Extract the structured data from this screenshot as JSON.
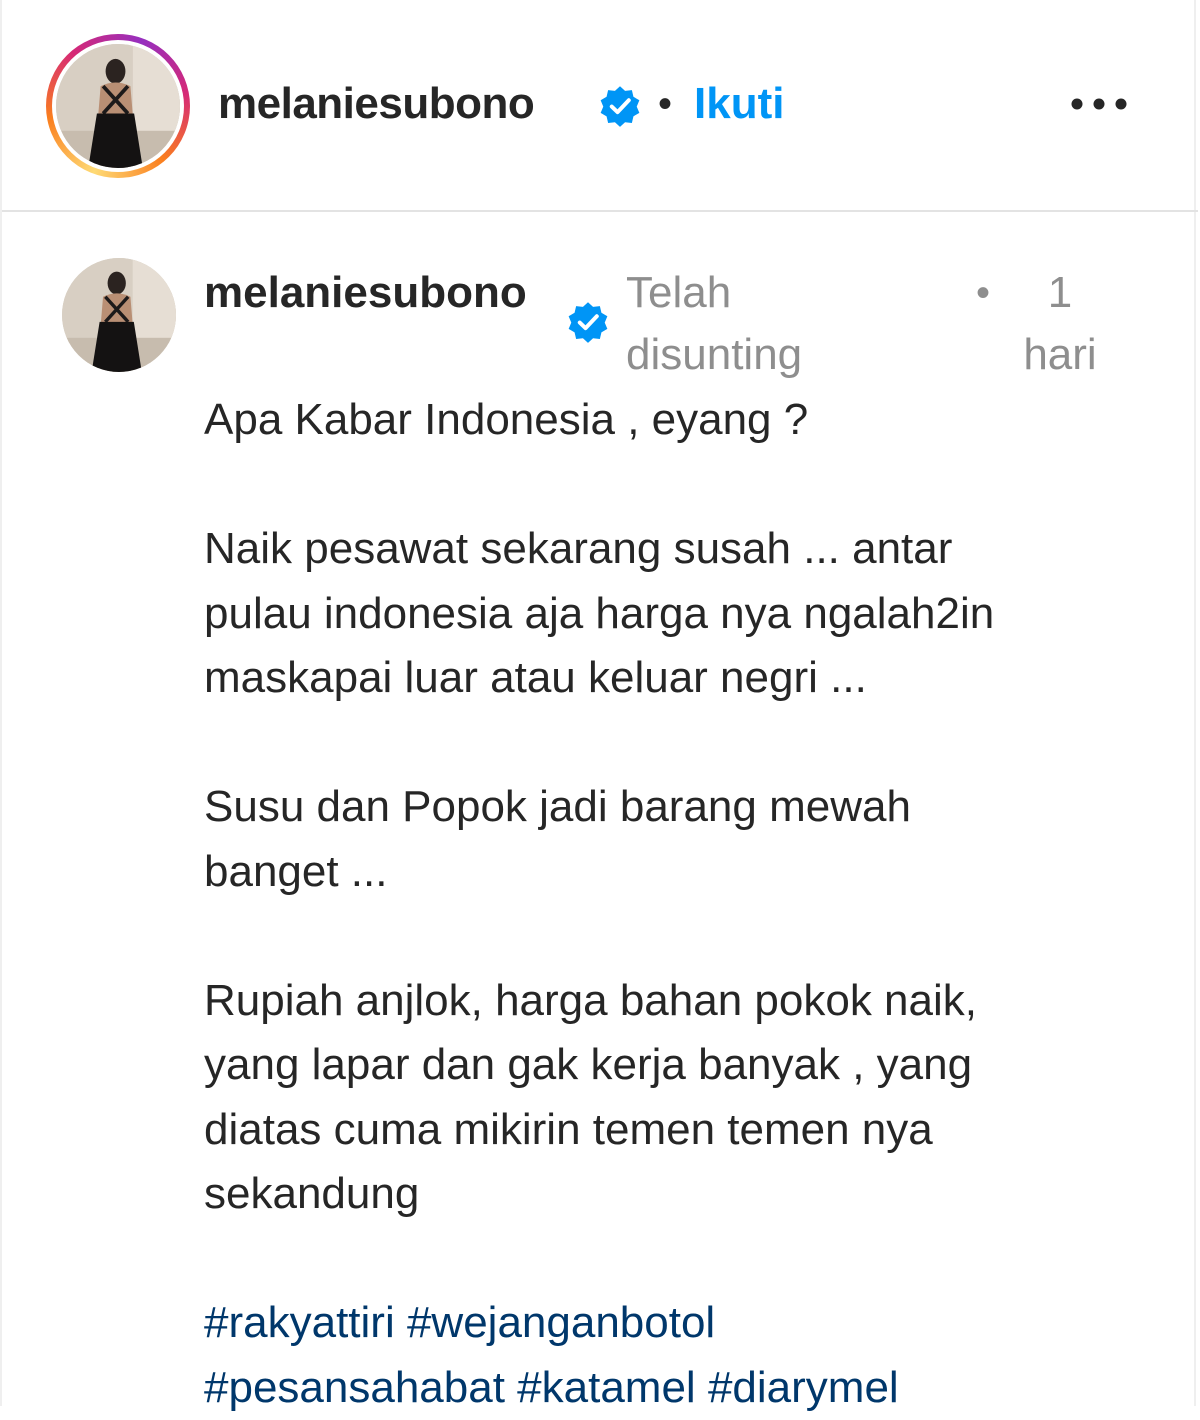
{
  "header": {
    "username": "melaniesubono",
    "separator": "•",
    "follow_label": "Ikuti",
    "more_icon": "more-horizontal-icon"
  },
  "caption": {
    "username": "melaniesubono",
    "edited_label": "Telah disunting",
    "separator": "•",
    "time": "1 hari",
    "paragraphs": [
      [
        "Apa Kabar Indonesia , eyang ?"
      ],
      [
        "Naik pesawat sekarang susah ... antar",
        "pulau indonesia aja harga nya ngalah2in",
        "maskapai luar atau keluar negri ..."
      ],
      [
        "Susu dan Popok jadi barang mewah",
        "banget ..."
      ],
      [
        "Rupiah anjlok, harga bahan pokok naik,",
        "yang lapar dan gak kerja banyak , yang",
        "diatas cuma mikirin temen temen nya",
        "sekandung"
      ]
    ],
    "hashtags": [
      "#rakyattiri",
      "#wejanganbotol",
      "#pesansahabat",
      "#katamel",
      "#diarymel"
    ]
  },
  "colors": {
    "verified": "#0095f6",
    "follow": "#0095f6",
    "hashtag": "#00376b",
    "meta": "#8e8e8e"
  }
}
